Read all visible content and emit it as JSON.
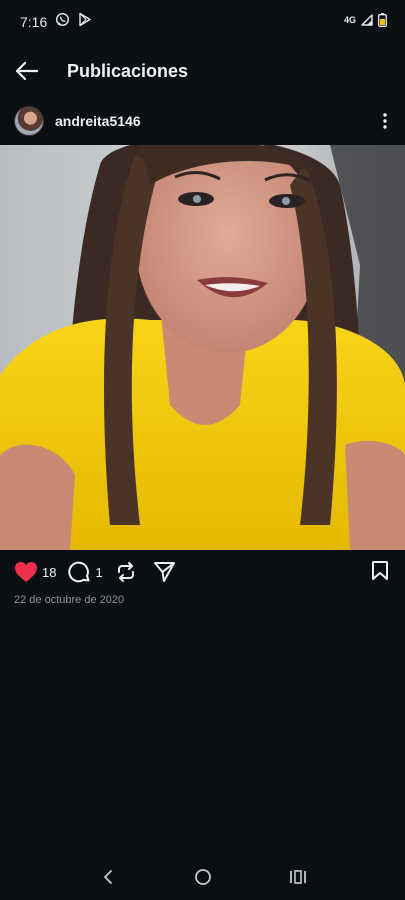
{
  "status_bar": {
    "time": "7:16",
    "network": "4G",
    "notification_icons": [
      "whatsapp-icon",
      "play-store-icon"
    ],
    "battery_color": "#f2c200"
  },
  "header": {
    "title": "Publicaciones",
    "back_icon": "arrow-left-icon"
  },
  "post": {
    "username": "andreita5146",
    "likes": "18",
    "comments": "1",
    "date": "22 de octubre de 2020",
    "liked": true,
    "like_color": "#f0304a"
  },
  "nav": {
    "buttons": [
      "back-icon",
      "home-icon",
      "recents-icon"
    ]
  }
}
